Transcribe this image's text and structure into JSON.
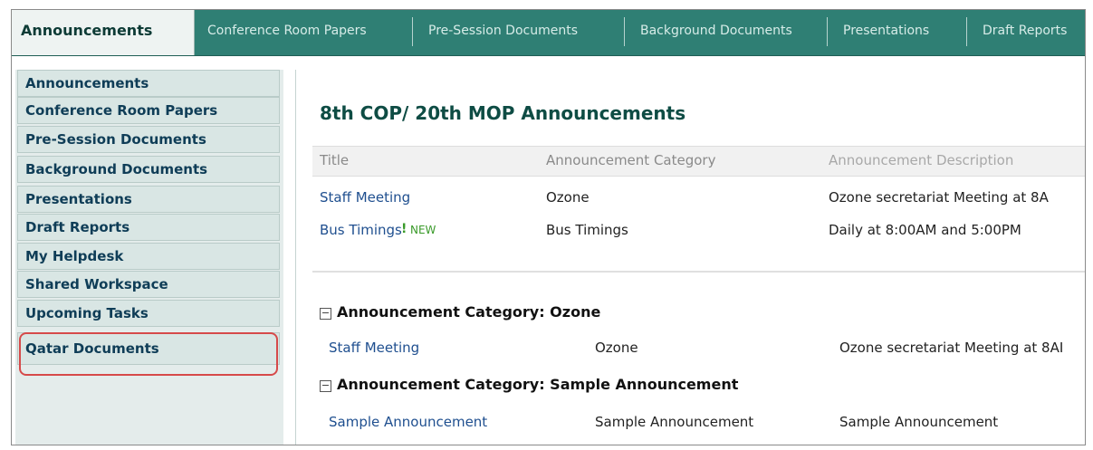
{
  "tabs": [
    {
      "label": "Announcements",
      "active": true
    },
    {
      "label": "Conference Room Papers",
      "active": false
    },
    {
      "label": "Pre-Session Documents",
      "active": false
    },
    {
      "label": "Background Documents",
      "active": false
    },
    {
      "label": "Presentations",
      "active": false
    },
    {
      "label": "Draft Reports",
      "active": false
    }
  ],
  "sidebar": {
    "items": [
      {
        "label": "Announcements"
      },
      {
        "label": "Conference Room Papers"
      },
      {
        "label": "Pre-Session Documents"
      },
      {
        "label": "Background Documents"
      },
      {
        "label": "Presentations"
      },
      {
        "label": "Draft Reports"
      },
      {
        "label": "My Helpdesk"
      },
      {
        "label": "Shared Workspace"
      },
      {
        "label": "Upcoming Tasks"
      },
      {
        "label": "Qatar Documents",
        "highlighted": true
      }
    ]
  },
  "main": {
    "title": "8th COP/ 20th MOP Announcements",
    "columns": {
      "title": "Title",
      "category": "Announcement Category",
      "description": "Announcement Description"
    },
    "rows": [
      {
        "title": "Staff Meeting",
        "category": "Ozone",
        "description": "Ozone secretariat Meeting at 8A"
      },
      {
        "title": "Bus Timings",
        "new_mark": "!",
        "new_label": "NEW",
        "category": "Bus Timings",
        "description": "Daily at 8:00AM and 5:00PM"
      }
    ],
    "groups": [
      {
        "collapse_glyph": "−",
        "header": "Announcement Category: Ozone",
        "rows": [
          {
            "title": "Staff Meeting",
            "category": "Ozone",
            "description": "Ozone secretariat Meeting at 8AI"
          }
        ]
      },
      {
        "collapse_glyph": "−",
        "header": "Announcement Category: Sample Announcement",
        "rows": [
          {
            "title": "Sample Announcement",
            "category": "Sample Announcement",
            "description": "Sample Announcement"
          }
        ]
      }
    ]
  },
  "colors": {
    "tab_bar": "#2f7f74",
    "active_tab_bg": "#eef3f2",
    "sidebar_bg": "#d9e6e4",
    "sidebar_text": "#0f3d57",
    "title_color": "#0e4c44",
    "link": "#1f4f8f",
    "new_badge": "#3a9a2a",
    "highlight_ring": "#d64a4a"
  },
  "icons": {
    "collapse": "minus-box-icon"
  }
}
